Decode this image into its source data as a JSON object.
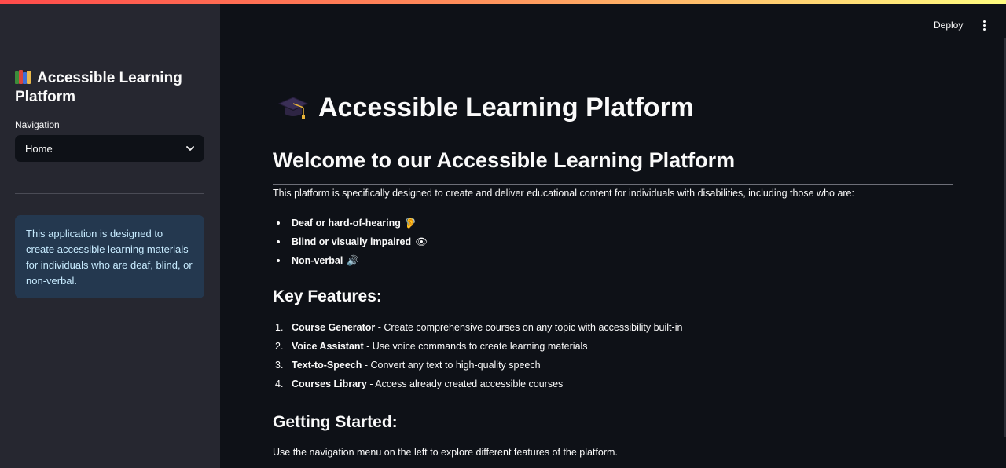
{
  "sidebar": {
    "title": "Accessible Learning Platform",
    "title_icon": "books-icon",
    "nav_label": "Navigation",
    "nav_selected": "Home",
    "info": "This application is designed to create accessible learning materials for individuals who are deaf, blind, or non-verbal."
  },
  "header": {
    "deploy_label": "Deploy",
    "menu_icon": "kebab-menu-icon"
  },
  "main": {
    "title": "Accessible Learning Platform",
    "title_icon": "graduation-cap-icon",
    "welcome_heading": "Welcome to our Accessible Learning Platform",
    "intro": "This platform is specifically designed to create and deliver educational content for individuals with disabilities, including those who are:",
    "audiences": [
      {
        "label": "Deaf or hard-of-hearing",
        "emoji": "🦻"
      },
      {
        "label": "Blind or visually impaired",
        "emoji": "👁"
      },
      {
        "label": "Non-verbal",
        "emoji": "🔊"
      }
    ],
    "features_heading": "Key Features:",
    "features": [
      {
        "num": "1.",
        "name": "Course Generator",
        "desc": " - Create comprehensive courses on any topic with accessibility built-in"
      },
      {
        "num": "2.",
        "name": "Voice Assistant",
        "desc": " - Use voice commands to create learning materials"
      },
      {
        "num": "3.",
        "name": "Text-to-Speech",
        "desc": " - Convert any text to high-quality speech"
      },
      {
        "num": "4.",
        "name": "Courses Library",
        "desc": " - Access already created accessible courses"
      }
    ],
    "getting_started_heading": "Getting Started:",
    "getting_started_text": "Use the navigation menu on the left to explore different features of the platform."
  },
  "colors": {
    "background": "#0e1117",
    "sidebar": "#262730",
    "info_box": "#24384f",
    "info_text": "#c7ebff"
  }
}
